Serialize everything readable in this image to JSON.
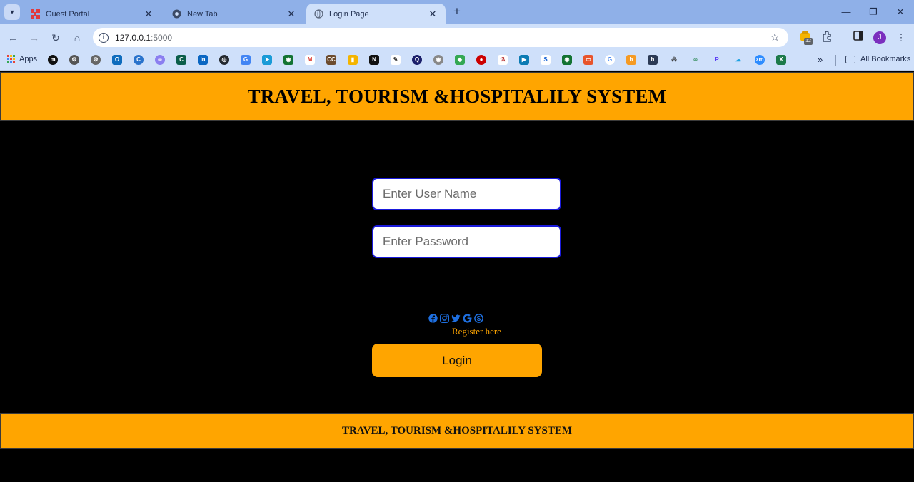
{
  "browser": {
    "tabs": [
      {
        "title": "Guest Portal",
        "icon": "fortinet-icon"
      },
      {
        "title": "New Tab",
        "icon": "chrome-icon"
      },
      {
        "title": "Login Page",
        "icon": "globe-icon",
        "active": true
      }
    ],
    "address": {
      "host": "127.0.0.1",
      "port": ":5000"
    },
    "extension_badge": "12",
    "profile_initial": "J",
    "bookmarks": {
      "apps_label": "Apps",
      "all_label": "All Bookmarks",
      "icon_names": [
        "medium-icon",
        "settings-icon",
        "settings-icon",
        "outlook-icon",
        "coursera-icon",
        "copilot-icon",
        "chegg-icon",
        "linkedin-icon",
        "github-icon",
        "translate-icon",
        "send-icon",
        "bookmark-icon",
        "gmail-icon",
        "cc-icon",
        "charts-icon",
        "news-icon",
        "pencil-icon",
        "q-icon",
        "eye-icon",
        "maps-icon",
        "redhat-icon",
        "lab-icon",
        "play-icon",
        "s-icon",
        "bookmark-icon",
        "brand-icon",
        "google-icon",
        "h-icon",
        "h-icon",
        "grid-icon",
        "link-icon",
        "p-icon",
        "cloud-icon",
        "zoom-icon",
        "excel-icon"
      ]
    }
  },
  "page": {
    "header_title": "TRAVEL, TOURISM &HOSPITALILY SYSTEM",
    "username_placeholder": "Enter User Name",
    "password_placeholder": "Enter Password",
    "login_label": "Login",
    "social_icons": [
      "facebook-icon",
      "instagram-icon",
      "twitter-icon",
      "google-icon",
      "skype-icon"
    ],
    "register_label": "Register here",
    "footer_title": "TRAVEL, TOURISM &HOSPITALILY SYSTEM"
  },
  "colors": {
    "accent": "#ffa500",
    "social": "#1e6fe0",
    "input_border": "#1a1adb"
  }
}
